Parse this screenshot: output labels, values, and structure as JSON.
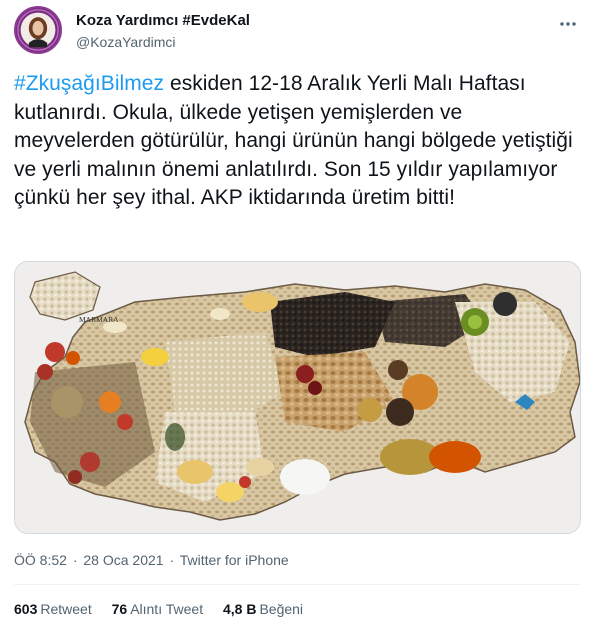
{
  "author": {
    "display_name": "Koza Yardımcı #EvdeKal",
    "handle": "@KozaYardimci"
  },
  "tweet": {
    "hashtag": "#ZkuşağıBilmez",
    "text": " eskiden 12-18 Aralık Yerli Malı Haftası kutlanırdı. Okula, ülkede yetişen yemişlerden ve meyvelerden götürülür, hangi ürünün hangi bölgede yetiştiği ve yerli malının önemi anlatılırdı. Son 15 yıldır yapılamıyor çünkü her şey ithal. AKP iktidarında üretim bitti!"
  },
  "media": {
    "map_label": "MARMARA"
  },
  "meta": {
    "time": "ÖÖ 8:52",
    "date": "28 Oca 2021",
    "separator": "·",
    "source": "Twitter for iPhone"
  },
  "stats": {
    "retweets": {
      "count": "603",
      "label": "Retweet"
    },
    "quotes": {
      "count": "76",
      "label": "Alıntı Tweet"
    },
    "likes": {
      "count": "4,8 B",
      "label": "Beğeni"
    }
  },
  "colors": {
    "accent": "#1d9bf0",
    "secondary_text": "#536471"
  },
  "icons": {
    "more": "more-horizontal-icon"
  }
}
